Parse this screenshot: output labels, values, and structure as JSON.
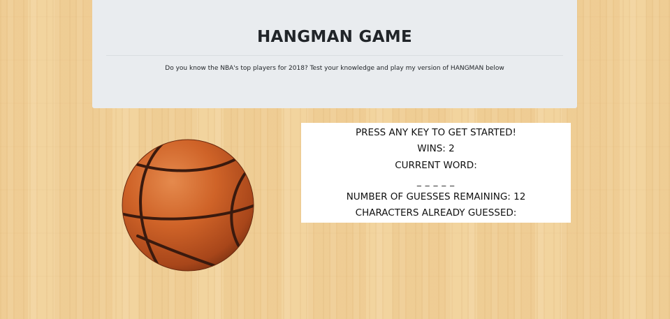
{
  "header": {
    "title": "HANGMAN GAME",
    "lead": "Do you know the NBA's top players for 2018? Test your knowledge and play my version of HANGMAN below"
  },
  "image": {
    "name": "basketball"
  },
  "game": {
    "prompt": "PRESS ANY KEY TO GET STARTED!",
    "wins": "WINS: 2",
    "current_word_label": "CURRENT WORD:",
    "current_word": "_ _ _ _ _",
    "guesses_remaining": "NUMBER OF GUESSES REMAINING: 12",
    "guessed_label": "CHARACTERS ALREADY GUESSED:"
  },
  "colors": {
    "jumbotron_bg": "#e9ecef",
    "panel_bg": "#ffffff",
    "ball_orange": "#c8581f",
    "seam": "#3a1a0e"
  }
}
